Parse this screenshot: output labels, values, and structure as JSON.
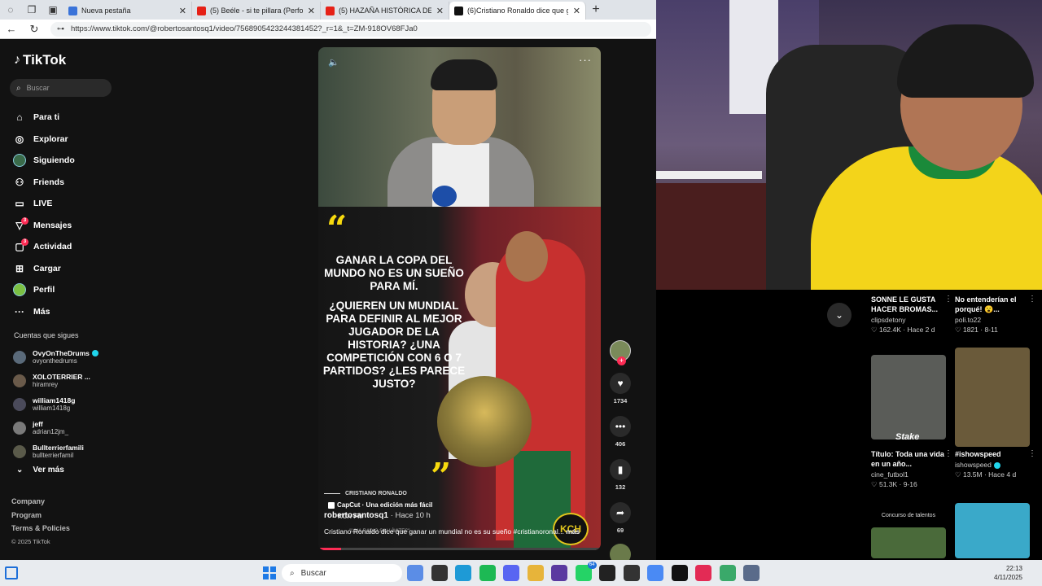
{
  "browser": {
    "tabs": [
      {
        "title": "Nueva pestaña",
        "favicon_color": "#3a73d9",
        "active": false
      },
      {
        "title": "(5) Beéle - si te pillara (Performan",
        "favicon_color": "#e62117",
        "active": false
      },
      {
        "title": "(5) HAZAÑA HISTÓRICA DEL VERD",
        "favicon_color": "#e62117",
        "active": false
      },
      {
        "title": "(6)Cristiano Ronaldo dice que gar",
        "favicon_color": "#111111",
        "active": true
      }
    ],
    "url": "https://www.tiktok.com/@robertosantosq1/video/7568905423244381452?_r=1&_t=ZM-918OV68FJa0"
  },
  "tiktok": {
    "logo": "TikTok",
    "search_placeholder": "Buscar",
    "nav": [
      {
        "label": "Para ti",
        "icon": "home-icon"
      },
      {
        "label": "Explorar",
        "icon": "compass-icon"
      },
      {
        "label": "Siguiendo",
        "icon": "following-avatar-icon"
      },
      {
        "label": "Friends",
        "icon": "friends-icon"
      },
      {
        "label": "LIVE",
        "icon": "live-icon"
      },
      {
        "label": "Mensajes",
        "icon": "messages-icon",
        "badge": "3"
      },
      {
        "label": "Actividad",
        "icon": "activity-icon",
        "badge": "3"
      },
      {
        "label": "Cargar",
        "icon": "upload-icon"
      },
      {
        "label": "Perfil",
        "icon": "profile-icon"
      },
      {
        "label": "Más",
        "icon": "more-icon"
      }
    ],
    "following_header": "Cuentas que sigues",
    "following": [
      {
        "name": "OvyOnTheDrums",
        "handle": "ovyonthedrums",
        "verified": true
      },
      {
        "name": "XOLOTERRIER ...",
        "handle": "hiramrey",
        "verified": false
      },
      {
        "name": "william1418g",
        "handle": "william1418g",
        "verified": false
      },
      {
        "name": "jeff",
        "handle": "adrian12jm_",
        "verified": false
      },
      {
        "name": "Bullterrierfamili",
        "handle": "bullterrierfamil",
        "verified": false
      }
    ],
    "see_more": "Ver más",
    "footer": [
      "Company",
      "Program",
      "Terms & Policies"
    ],
    "copyright": "© 2025 TikTok"
  },
  "video": {
    "overlay_text": [
      "GANAR LA COPA DEL MUNDO NO ES UN SUEÑO PARA MÍ.",
      "¿QUIEREN UN MUNDIAL PARA DEFINIR AL MEJOR JUGADOR DE LA HISTORIA? ¿UNA COMPETICIÓN CON 6 O 7 PARTIDOS? ¿LES PARECE JUSTO?"
    ],
    "credit": "CRISTIANO RONALDO",
    "capcut": "CapCut · Una edición más fácil",
    "kch_fm": "KCH FM",
    "radio_tagline": "\"UNA RADIO SIN LÍMITES\"",
    "kch_logo": "KCH",
    "author": "robertosantosq1",
    "time_ago": "· Hace 10 h",
    "caption": "Cristiano Ronaldo dice que ganar un mundial no es su sueño #cristianoronal...",
    "caption_more": "más",
    "progress": 0.08,
    "actions": [
      {
        "name": "like",
        "icon": "heart-icon",
        "glyph": "♥",
        "count": "1734"
      },
      {
        "name": "comment",
        "icon": "comment-icon",
        "glyph": "•••",
        "count": "406"
      },
      {
        "name": "bookmark",
        "icon": "bookmark-icon",
        "glyph": "▮",
        "count": "132"
      },
      {
        "name": "share",
        "icon": "share-icon",
        "glyph": "➦",
        "count": "69"
      }
    ]
  },
  "feed": {
    "cards_top": [
      {
        "title": "SONNE LE GUSTA HACER BROMAS...",
        "user": "clipsdetony",
        "stats": "♡ 162.4K · Hace 2 d"
      },
      {
        "title": "No entenderían el porqué! 😮...",
        "user": "poli.to22",
        "stats": "♡ 1821 · 8-11"
      }
    ],
    "cards_mid": [
      {
        "title": "Título: Toda una vida en un año...",
        "user": "cine_futbol1",
        "stats": "♡ 51.3K · 9-16",
        "thumb_label": "Stake",
        "thumb_color": "#5a5c58"
      },
      {
        "title": "#ishowspeed",
        "user": "ishowspeed",
        "verified": true,
        "stats": "♡ 13.5M · Hace 4 d",
        "thumb_color": "#6a5a3a"
      }
    ],
    "talent_label": "Concurso de talentos"
  },
  "taskbar": {
    "search": "Buscar",
    "whatsapp_badge": "64",
    "time": "22:13",
    "date": "4/11/2025"
  }
}
